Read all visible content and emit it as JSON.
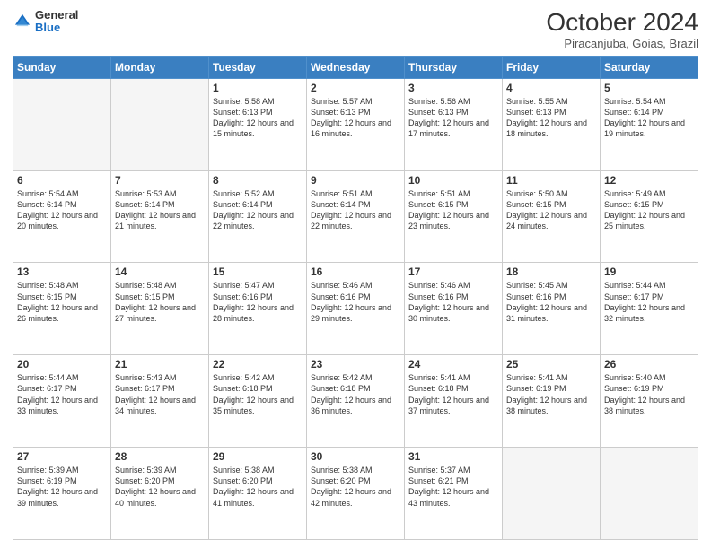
{
  "header": {
    "logo_general": "General",
    "logo_blue": "Blue",
    "title": "October 2024",
    "subtitle": "Piracanjuba, Goias, Brazil"
  },
  "days_of_week": [
    "Sunday",
    "Monday",
    "Tuesday",
    "Wednesday",
    "Thursday",
    "Friday",
    "Saturday"
  ],
  "weeks": [
    [
      {
        "day": "",
        "info": ""
      },
      {
        "day": "",
        "info": ""
      },
      {
        "day": "1",
        "info": "Sunrise: 5:58 AM\nSunset: 6:13 PM\nDaylight: 12 hours and 15 minutes."
      },
      {
        "day": "2",
        "info": "Sunrise: 5:57 AM\nSunset: 6:13 PM\nDaylight: 12 hours and 16 minutes."
      },
      {
        "day": "3",
        "info": "Sunrise: 5:56 AM\nSunset: 6:13 PM\nDaylight: 12 hours and 17 minutes."
      },
      {
        "day": "4",
        "info": "Sunrise: 5:55 AM\nSunset: 6:13 PM\nDaylight: 12 hours and 18 minutes."
      },
      {
        "day": "5",
        "info": "Sunrise: 5:54 AM\nSunset: 6:14 PM\nDaylight: 12 hours and 19 minutes."
      }
    ],
    [
      {
        "day": "6",
        "info": "Sunrise: 5:54 AM\nSunset: 6:14 PM\nDaylight: 12 hours and 20 minutes."
      },
      {
        "day": "7",
        "info": "Sunrise: 5:53 AM\nSunset: 6:14 PM\nDaylight: 12 hours and 21 minutes."
      },
      {
        "day": "8",
        "info": "Sunrise: 5:52 AM\nSunset: 6:14 PM\nDaylight: 12 hours and 22 minutes."
      },
      {
        "day": "9",
        "info": "Sunrise: 5:51 AM\nSunset: 6:14 PM\nDaylight: 12 hours and 22 minutes."
      },
      {
        "day": "10",
        "info": "Sunrise: 5:51 AM\nSunset: 6:15 PM\nDaylight: 12 hours and 23 minutes."
      },
      {
        "day": "11",
        "info": "Sunrise: 5:50 AM\nSunset: 6:15 PM\nDaylight: 12 hours and 24 minutes."
      },
      {
        "day": "12",
        "info": "Sunrise: 5:49 AM\nSunset: 6:15 PM\nDaylight: 12 hours and 25 minutes."
      }
    ],
    [
      {
        "day": "13",
        "info": "Sunrise: 5:48 AM\nSunset: 6:15 PM\nDaylight: 12 hours and 26 minutes."
      },
      {
        "day": "14",
        "info": "Sunrise: 5:48 AM\nSunset: 6:15 PM\nDaylight: 12 hours and 27 minutes."
      },
      {
        "day": "15",
        "info": "Sunrise: 5:47 AM\nSunset: 6:16 PM\nDaylight: 12 hours and 28 minutes."
      },
      {
        "day": "16",
        "info": "Sunrise: 5:46 AM\nSunset: 6:16 PM\nDaylight: 12 hours and 29 minutes."
      },
      {
        "day": "17",
        "info": "Sunrise: 5:46 AM\nSunset: 6:16 PM\nDaylight: 12 hours and 30 minutes."
      },
      {
        "day": "18",
        "info": "Sunrise: 5:45 AM\nSunset: 6:16 PM\nDaylight: 12 hours and 31 minutes."
      },
      {
        "day": "19",
        "info": "Sunrise: 5:44 AM\nSunset: 6:17 PM\nDaylight: 12 hours and 32 minutes."
      }
    ],
    [
      {
        "day": "20",
        "info": "Sunrise: 5:44 AM\nSunset: 6:17 PM\nDaylight: 12 hours and 33 minutes."
      },
      {
        "day": "21",
        "info": "Sunrise: 5:43 AM\nSunset: 6:17 PM\nDaylight: 12 hours and 34 minutes."
      },
      {
        "day": "22",
        "info": "Sunrise: 5:42 AM\nSunset: 6:18 PM\nDaylight: 12 hours and 35 minutes."
      },
      {
        "day": "23",
        "info": "Sunrise: 5:42 AM\nSunset: 6:18 PM\nDaylight: 12 hours and 36 minutes."
      },
      {
        "day": "24",
        "info": "Sunrise: 5:41 AM\nSunset: 6:18 PM\nDaylight: 12 hours and 37 minutes."
      },
      {
        "day": "25",
        "info": "Sunrise: 5:41 AM\nSunset: 6:19 PM\nDaylight: 12 hours and 38 minutes."
      },
      {
        "day": "26",
        "info": "Sunrise: 5:40 AM\nSunset: 6:19 PM\nDaylight: 12 hours and 38 minutes."
      }
    ],
    [
      {
        "day": "27",
        "info": "Sunrise: 5:39 AM\nSunset: 6:19 PM\nDaylight: 12 hours and 39 minutes."
      },
      {
        "day": "28",
        "info": "Sunrise: 5:39 AM\nSunset: 6:20 PM\nDaylight: 12 hours and 40 minutes."
      },
      {
        "day": "29",
        "info": "Sunrise: 5:38 AM\nSunset: 6:20 PM\nDaylight: 12 hours and 41 minutes."
      },
      {
        "day": "30",
        "info": "Sunrise: 5:38 AM\nSunset: 6:20 PM\nDaylight: 12 hours and 42 minutes."
      },
      {
        "day": "31",
        "info": "Sunrise: 5:37 AM\nSunset: 6:21 PM\nDaylight: 12 hours and 43 minutes."
      },
      {
        "day": "",
        "info": ""
      },
      {
        "day": "",
        "info": ""
      }
    ]
  ]
}
